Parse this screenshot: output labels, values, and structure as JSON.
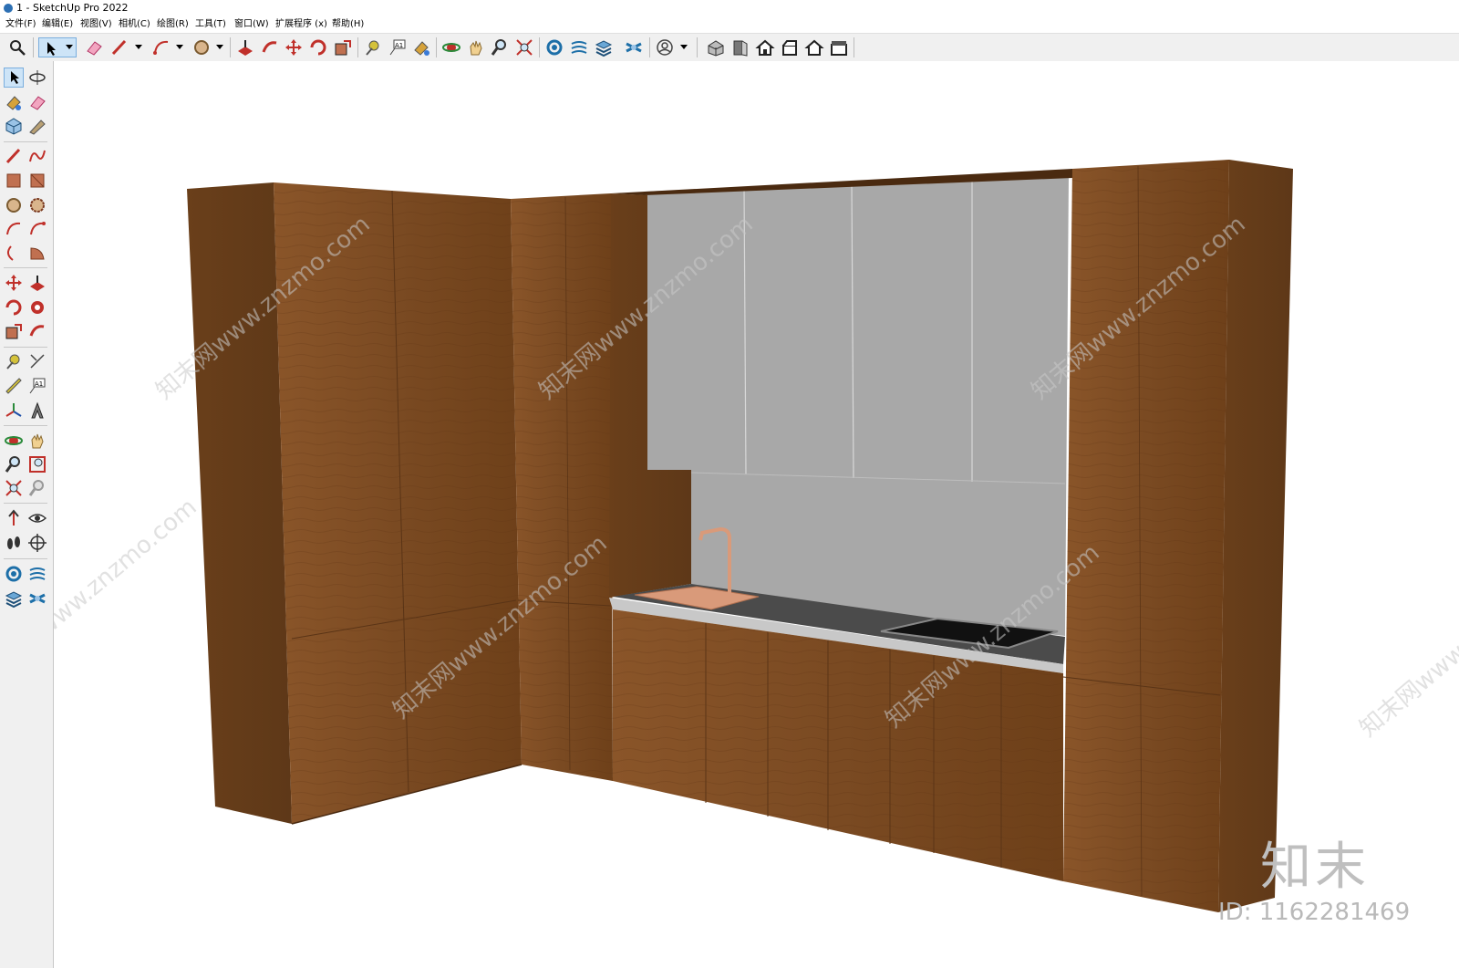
{
  "window": {
    "title": "1 - SketchUp Pro 2022"
  },
  "menu": [
    "文件(F)",
    "编辑(E)",
    "视图(V)",
    "相机(C)",
    "绘图(R)",
    "工具(T)",
    "窗口(W)",
    "扩展程序 (x)",
    "帮助(H)"
  ],
  "toolbar": {
    "items": [
      "search-icon",
      "select-icon",
      "eraser-icon",
      "pencil-icon",
      "arc-icon",
      "circle-icon",
      "push-pull-icon",
      "follow-me-icon",
      "move-icon",
      "rotate-icon",
      "scale-icon",
      "tape-icon",
      "text-icon",
      "paint-icon",
      "orbit-icon",
      "pan-icon",
      "zoom-icon",
      "zoom-extents-icon",
      "solid-tools-icon",
      "sandbox-icon",
      "layers-icon",
      "styles-icon",
      "account-icon",
      "iso-view-icon",
      "front-view-icon",
      "top-view-icon",
      "right-view-icon",
      "back-view-icon",
      "left-view-icon"
    ]
  },
  "left_toolbar": {
    "items": [
      "select-icon",
      "orbit-icon",
      "paint-icon",
      "eraser-icon",
      "component-icon",
      "tape-icon",
      "line-icon",
      "freehand-icon",
      "rectangle-icon",
      "rotated-rectangle-icon",
      "circle-icon",
      "polygon-icon",
      "arc-icon",
      "two-point-arc-icon",
      "three-point-arc-icon",
      "pie-icon",
      "move-icon",
      "push-pull-icon",
      "rotate-icon",
      "follow-me-icon",
      "scale-icon",
      "offset-icon",
      "tape-measure-icon",
      "dimension-icon",
      "protractor-icon",
      "text-icon",
      "axes-icon",
      "3d-text-icon",
      "orbit-tool-icon",
      "pan-tool-icon",
      "zoom-tool-icon",
      "zoom-window-icon",
      "zoom-extents-tool-icon",
      "previous-view-icon",
      "position-camera-icon",
      "look-around-icon",
      "walk-icon",
      "section-plane-icon",
      "outer-shell-icon",
      "intersect-icon",
      "union-icon",
      "subtract-icon"
    ]
  },
  "watermark": {
    "text": "知末网www.znzmo.com",
    "brand": "知末",
    "id_text": "ID: 1162281469"
  },
  "colors": {
    "wood": "#7a4a22",
    "wood_dark": "#5e3818",
    "panel_gray": "#a7a7a7",
    "countertop": "#4b4b4b",
    "sink": "#d99a7a",
    "accent": "#7aaede"
  }
}
